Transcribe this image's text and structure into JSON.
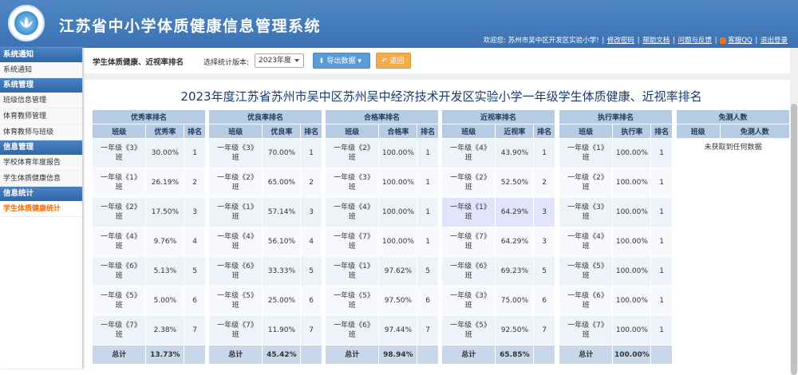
{
  "header": {
    "title": "江苏省中小学体质健康信息管理系统",
    "welcome": "欢迎您: 苏州市吴中区开发区实验小学!",
    "links": [
      "修改密码",
      "帮助文档",
      "问题与反馈",
      "客服QQ",
      "退出登录"
    ]
  },
  "sidebar": [
    {
      "heading": "系统通知",
      "items": [
        {
          "label": "系统通知",
          "active": false
        }
      ]
    },
    {
      "heading": "系统管理",
      "items": [
        {
          "label": "班级信息管理",
          "active": false
        },
        {
          "label": "体育教师管理",
          "active": false
        },
        {
          "label": "体育教师与班级",
          "active": false
        }
      ]
    },
    {
      "heading": "信息管理",
      "items": [
        {
          "label": "学校体育年度报告",
          "active": false
        },
        {
          "label": "学生体质健康信息",
          "active": false
        }
      ]
    },
    {
      "heading": "信息统计",
      "items": [
        {
          "label": "学生体质健康统计",
          "active": true
        }
      ]
    }
  ],
  "toolbar": {
    "title": "学生体质健康、近视率排名",
    "version_label": "选择统计版本:",
    "version_value": "2023年度",
    "export_label": "导出数据",
    "back_label": "返回"
  },
  "page_title": "2023年度江苏省苏州市吴中区苏州吴中经济技术开发区实验小学一年级学生体质健康、近视率排名",
  "tables": [
    {
      "title": "优秀率排名",
      "cols": [
        "班级",
        "优秀率",
        "排名"
      ],
      "total": [
        "总计",
        "13.73%",
        ""
      ],
      "rows": [
        [
          "一年级《3》班",
          "30.00%",
          "1"
        ],
        [
          "一年级《1》班",
          "26.19%",
          "2"
        ],
        [
          "一年级《2》班",
          "17.50%",
          "3"
        ],
        [
          "一年级《4》班",
          "9.76%",
          "4"
        ],
        [
          "一年级《6》班",
          "5.13%",
          "5"
        ],
        [
          "一年级《5》班",
          "5.00%",
          "6"
        ],
        [
          "一年级《7》班",
          "2.38%",
          "7"
        ]
      ]
    },
    {
      "title": "优良率排名",
      "cols": [
        "班级",
        "优良率",
        "排名"
      ],
      "total": [
        "总计",
        "45.42%",
        ""
      ],
      "rows": [
        [
          "一年级《3》班",
          "70.00%",
          "1"
        ],
        [
          "一年级《2》班",
          "65.00%",
          "2"
        ],
        [
          "一年级《1》班",
          "57.14%",
          "3"
        ],
        [
          "一年级《4》班",
          "56.10%",
          "4"
        ],
        [
          "一年级《6》班",
          "33.33%",
          "5"
        ],
        [
          "一年级《5》班",
          "25.00%",
          "6"
        ],
        [
          "一年级《7》班",
          "11.90%",
          "7"
        ]
      ]
    },
    {
      "title": "合格率排名",
      "cols": [
        "班级",
        "合格率",
        "排名"
      ],
      "total": [
        "总计",
        "98.94%",
        ""
      ],
      "rows": [
        [
          "一年级《2》班",
          "100.00%",
          "1"
        ],
        [
          "一年级《3》班",
          "100.00%",
          "1"
        ],
        [
          "一年级《4》班",
          "100.00%",
          "1"
        ],
        [
          "一年级《7》班",
          "100.00%",
          "1"
        ],
        [
          "一年级《1》班",
          "97.62%",
          "5"
        ],
        [
          "一年级《5》班",
          "97.50%",
          "6"
        ],
        [
          "一年级《6》班",
          "97.44%",
          "7"
        ]
      ]
    },
    {
      "title": "近视率排名",
      "cols": [
        "班级",
        "近视率",
        "排名"
      ],
      "total": [
        "总计",
        "65.85%",
        ""
      ],
      "rows": [
        [
          "一年级《4》班",
          "43.90%",
          "1"
        ],
        [
          "一年级《2》班",
          "52.50%",
          "2"
        ],
        [
          "一年级《1》班",
          "64.29%",
          "3"
        ],
        [
          "一年级《7》班",
          "64.29%",
          "3"
        ],
        [
          "一年级《6》班",
          "69.23%",
          "5"
        ],
        [
          "一年级《3》班",
          "75.00%",
          "6"
        ],
        [
          "一年级《5》班",
          "92.50%",
          "7"
        ]
      ]
    },
    {
      "title": "执行率排名",
      "cols": [
        "班级",
        "执行率",
        "排名"
      ],
      "total": [
        "总计",
        "100.00%",
        ""
      ],
      "rows": [
        [
          "一年级《1》班",
          "100.00%",
          "1"
        ],
        [
          "一年级《2》班",
          "100.00%",
          "1"
        ],
        [
          "一年级《3》班",
          "100.00%",
          "1"
        ],
        [
          "一年级《4》班",
          "100.00%",
          "1"
        ],
        [
          "一年级《5》班",
          "100.00%",
          "1"
        ],
        [
          "一年级《6》班",
          "100.00%",
          "1"
        ],
        [
          "一年级《7》班",
          "100.00%",
          "1"
        ]
      ]
    }
  ],
  "exempt_table": {
    "title": "免测人数",
    "cols": [
      "班级",
      "免测人数"
    ],
    "empty_text": "未获取到任何数据"
  }
}
